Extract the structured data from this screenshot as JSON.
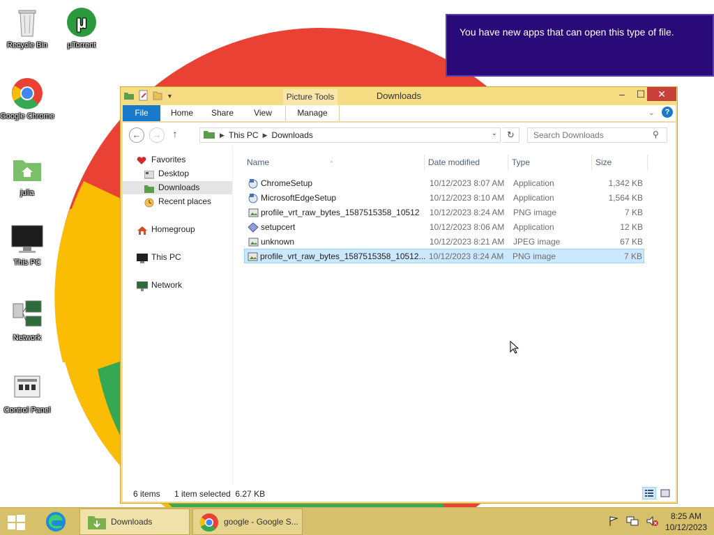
{
  "desktop": {
    "icons": [
      {
        "label": "Recycle Bin",
        "icon": "recycle-bin-icon"
      },
      {
        "label": "µTorrent",
        "icon": "utorrent-icon"
      },
      {
        "label": "Google Chrome",
        "icon": "chrome-icon"
      },
      {
        "label": "julia",
        "icon": "user-folder-icon"
      },
      {
        "label": "This PC",
        "icon": "monitor-icon"
      },
      {
        "label": "Network",
        "icon": "network-icon"
      },
      {
        "label": "Control Panel",
        "icon": "control-panel-icon"
      }
    ]
  },
  "toast": {
    "message": "You have new apps that can open this type of file."
  },
  "window": {
    "title": "Downloads",
    "context_tab": "Picture Tools",
    "ribbon_tabs": {
      "file": "File",
      "home": "Home",
      "share": "Share",
      "view": "View",
      "manage": "Manage"
    },
    "address": {
      "segments": [
        "This PC",
        "Downloads"
      ]
    },
    "search_placeholder": "Search Downloads",
    "nav": {
      "favorites": "Favorites",
      "desktop": "Desktop",
      "downloads": "Downloads",
      "recent": "Recent places",
      "homegroup": "Homegroup",
      "this_pc": "This PC",
      "network": "Network"
    },
    "columns": {
      "name": "Name",
      "date": "Date modified",
      "type": "Type",
      "size": "Size"
    },
    "files": [
      {
        "name": "ChromeSetup",
        "date": "10/12/2023 8:07 AM",
        "type": "Application",
        "size": "1,342 KB",
        "icon": "installer-icon"
      },
      {
        "name": "MicrosoftEdgeSetup",
        "date": "10/12/2023 8:10 AM",
        "type": "Application",
        "size": "1,564 KB",
        "icon": "installer-icon"
      },
      {
        "name": "profile_vrt_raw_bytes_1587515358_10512",
        "date": "10/12/2023 8:24 AM",
        "type": "PNG image",
        "size": "7 KB",
        "icon": "image-file-icon"
      },
      {
        "name": "setupcert",
        "date": "10/12/2023 8:06 AM",
        "type": "Application",
        "size": "12 KB",
        "icon": "diamond-app-icon"
      },
      {
        "name": "unknown",
        "date": "10/12/2023 8:21 AM",
        "type": "JPEG image",
        "size": "67 KB",
        "icon": "image-file-icon"
      },
      {
        "name": "profile_vrt_raw_bytes_1587515358_10512...",
        "date": "10/12/2023 8:24 AM",
        "type": "PNG image",
        "size": "7 KB",
        "icon": "image-file-icon"
      }
    ],
    "status": {
      "count": "6 items",
      "selection": "1 item selected  6.27 KB"
    }
  },
  "taskbar": {
    "items": [
      {
        "label": "Downloads"
      },
      {
        "label": "google - Google S..."
      }
    ],
    "clock": {
      "time": "8:25 AM",
      "date": "10/12/2023"
    }
  },
  "colors": {
    "file_tab": "#1979ca",
    "window_frame": "#f6dc83",
    "toast_bg": "#2a0a78",
    "selection": "#cce8ff",
    "close_button": "#c7403a"
  }
}
